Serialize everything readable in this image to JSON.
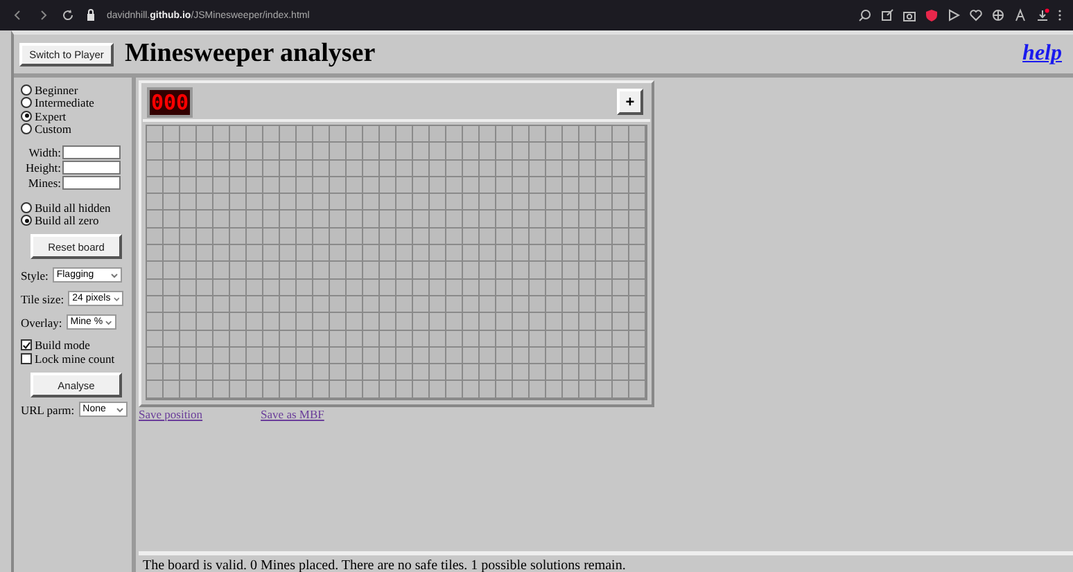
{
  "browser": {
    "url_host": "davidnhill.",
    "url_domain": "github.io",
    "url_path": "/JSMinesweeper/index.html"
  },
  "header": {
    "switch_button": "Switch to Player",
    "title": "Minesweeper analyser",
    "help_link": "help"
  },
  "sidebar": {
    "difficulty": [
      {
        "label": "Beginner",
        "selected": false
      },
      {
        "label": "Intermediate",
        "selected": false
      },
      {
        "label": "Expert",
        "selected": true
      },
      {
        "label": "Custom",
        "selected": false
      }
    ],
    "fields": [
      {
        "label": "Width:"
      },
      {
        "label": "Height:"
      },
      {
        "label": "Mines:"
      }
    ],
    "build": [
      {
        "label": "Build all hidden",
        "selected": false
      },
      {
        "label": "Build all zero",
        "selected": true
      }
    ],
    "reset_button": "Reset board",
    "selects": [
      {
        "label": "Style:",
        "value": "Flagging"
      },
      {
        "label": "Tile size:",
        "value": "24 pixels"
      },
      {
        "label": "Overlay:",
        "value": "Mine %"
      }
    ],
    "checkboxes": [
      {
        "label": "Build mode",
        "checked": true
      },
      {
        "label": "Lock mine count",
        "checked": false
      }
    ],
    "analyse_button": "Analyse",
    "url_parm": {
      "label": "URL parm:",
      "value": "None"
    }
  },
  "board": {
    "counter": "000",
    "add_button": "+"
  },
  "links": [
    "Save position",
    "Save as MBF"
  ],
  "status_bar": "The board is valid. 0 Mines placed. There are no safe tiles. 1 possible solutions remain."
}
